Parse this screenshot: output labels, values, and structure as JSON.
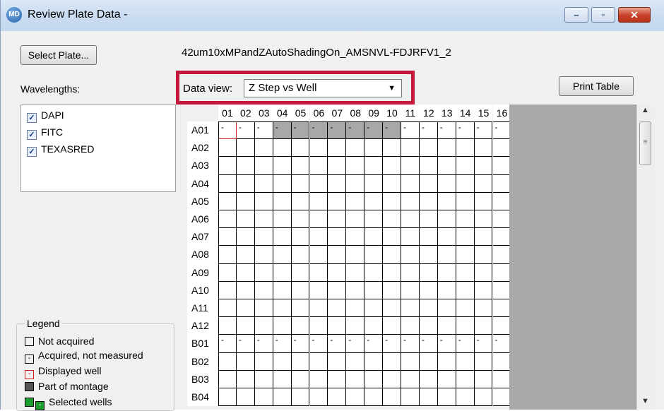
{
  "window": {
    "title": "Review Plate Data -",
    "icon_text": "MD",
    "min_glyph": "‒",
    "max_glyph": "▫",
    "close_glyph": "✕"
  },
  "toolbar": {
    "select_plate_label": "Select Plate...",
    "plate_name": "42um10xMPandZAutoShadingOn_AMSNVL-FDJRFV1_2",
    "print_table_label": "Print Table"
  },
  "wavelengths": {
    "label": "Wavelengths:",
    "items": [
      {
        "label": "DAPI",
        "checked": true
      },
      {
        "label": "FITC",
        "checked": true
      },
      {
        "label": "TEXASRED",
        "checked": true
      }
    ]
  },
  "data_view": {
    "label": "Data view:",
    "selected": "Z Step vs Well"
  },
  "grid": {
    "columns": [
      "01",
      "02",
      "03",
      "04",
      "05",
      "06",
      "07",
      "08",
      "09",
      "10",
      "11",
      "12",
      "13",
      "14",
      "15",
      "16"
    ],
    "rows": [
      "A01",
      "A02",
      "A03",
      "A04",
      "A05",
      "A06",
      "A07",
      "A08",
      "A09",
      "A10",
      "A11",
      "A12",
      "B01",
      "B02",
      "B03",
      "B04"
    ],
    "dash_rows": {
      "A01": true,
      "B01": true
    },
    "dash_text": "-",
    "montage_cols_a01": [
      "04",
      "05",
      "06",
      "07",
      "08",
      "09",
      "10"
    ],
    "displayed_well": {
      "row": "A01",
      "col": "01"
    }
  },
  "legend": {
    "title": "Legend",
    "items": [
      {
        "label": "Not acquired",
        "kind": "empty"
      },
      {
        "label": "Acquired, not measured",
        "kind": "dash"
      },
      {
        "label": "Displayed well",
        "kind": "red"
      },
      {
        "label": "Part of montage",
        "kind": "gray"
      },
      {
        "label": "Selected wells",
        "kind": "green"
      }
    ]
  },
  "colors": {
    "highlight": "#c4183c",
    "montage_gray": "#a8a8a8",
    "selected_green": "#1e9e2e"
  }
}
